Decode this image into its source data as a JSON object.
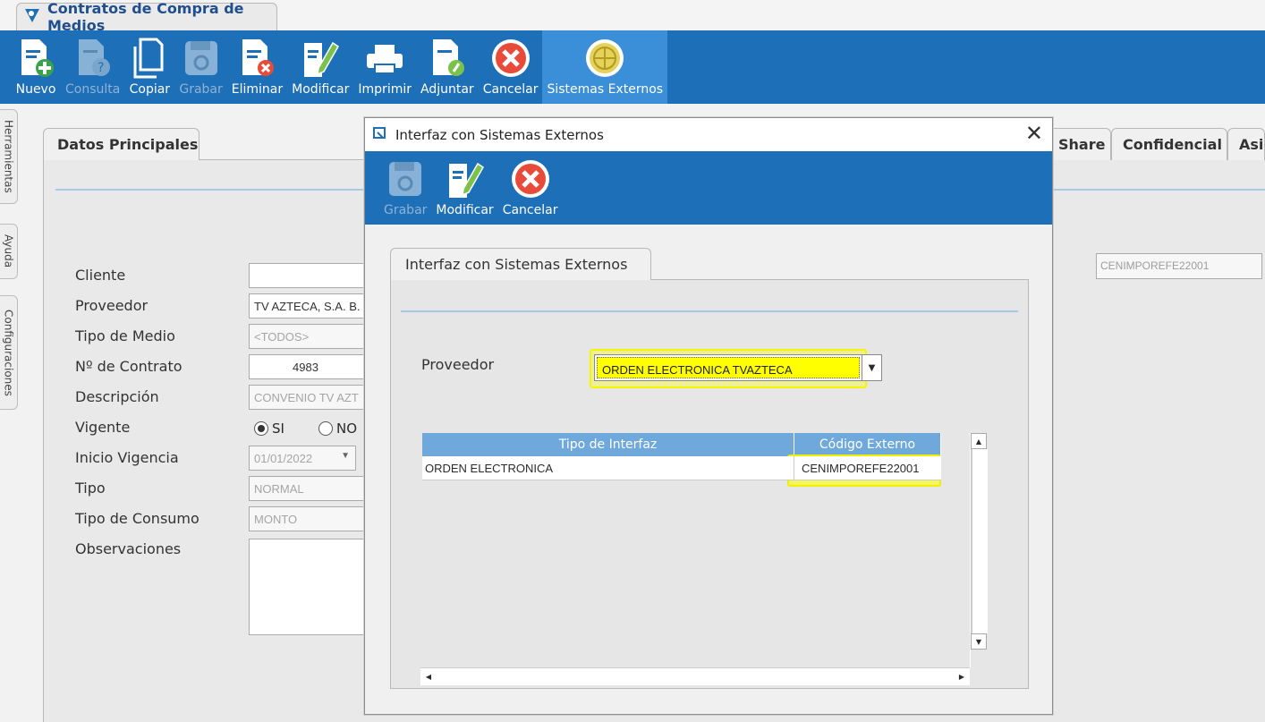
{
  "app": {
    "title": "Contratos de Compra de Medios"
  },
  "toolbar": {
    "nuevo": "Nuevo",
    "consulta": "Consulta",
    "copiar": "Copiar",
    "grabar": "Grabar",
    "eliminar": "Eliminar",
    "modificar": "Modificar",
    "imprimir": "Imprimir",
    "adjuntar": "Adjuntar",
    "cancelar": "Cancelar",
    "sistemas_externos": "Sistemas Externos"
  },
  "side_tabs": {
    "herramientas": "Herramientas",
    "ayuda": "Ayuda",
    "configuraciones": "Configuraciones"
  },
  "main": {
    "tab": "Datos Principales",
    "right_tabs": [
      "Share",
      "Confidencial",
      "Asig"
    ],
    "fields": {
      "cliente_label": "Cliente",
      "proveedor_label": "Proveedor",
      "proveedor_value": "TV AZTECA, S.A. B.",
      "tipo_medio_label": "Tipo de Medio",
      "tipo_medio_value": "<TODOS>",
      "contrato_label": "Nº de Contrato",
      "contrato_value": "4983",
      "descripcion_label": "Descripción",
      "descripcion_value": "CONVENIO TV AZT",
      "vigente_label": "Vigente",
      "vigente_si": "SI",
      "vigente_no": "NO",
      "inicio_label": "Inicio Vigencia",
      "inicio_value": "01/01/2022",
      "tipo_label": "Tipo",
      "tipo_value": "NORMAL",
      "consumo_label": "Tipo de Consumo",
      "consumo_value": "MONTO",
      "observaciones_label": "Observaciones"
    },
    "right_code": "CENIMPOREFE22001"
  },
  "modal": {
    "title": "Interfaz con Sistemas Externos",
    "toolbar": {
      "grabar": "Grabar",
      "modificar": "Modificar",
      "cancelar": "Cancelar"
    },
    "tab": "Interfaz con Sistemas Externos",
    "proveedor_label": "Proveedor",
    "proveedor_value": "ORDEN ELECTRONICA TVAZTECA",
    "grid": {
      "columns": [
        "Tipo de Interfaz",
        "Código Externo"
      ],
      "rows": [
        [
          "ORDEN ELECTRONICA",
          "CENIMPOREFE22001"
        ]
      ]
    },
    "close": "✕"
  },
  "colors": {
    "toolbar_blue": "#1d6fb8",
    "grid_header": "#6fa9dc",
    "highlight": "#ffff00"
  }
}
